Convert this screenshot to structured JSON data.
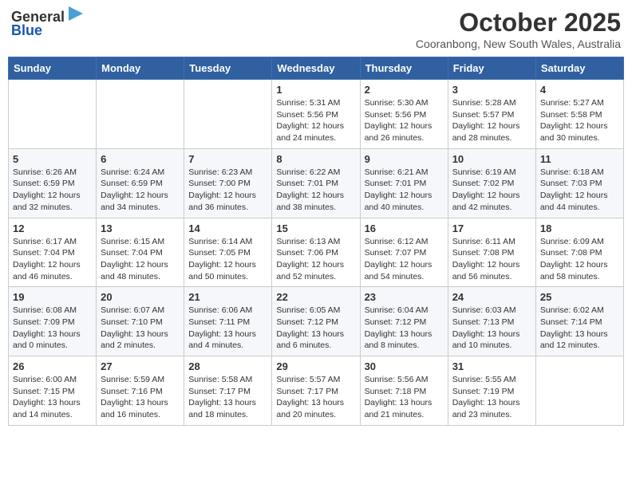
{
  "header": {
    "logo_line1": "General",
    "logo_line2": "Blue",
    "month": "October 2025",
    "location": "Cooranbong, New South Wales, Australia"
  },
  "weekdays": [
    "Sunday",
    "Monday",
    "Tuesday",
    "Wednesday",
    "Thursday",
    "Friday",
    "Saturday"
  ],
  "weeks": [
    [
      {
        "day": "",
        "info": ""
      },
      {
        "day": "",
        "info": ""
      },
      {
        "day": "",
        "info": ""
      },
      {
        "day": "1",
        "info": "Sunrise: 5:31 AM\nSunset: 5:56 PM\nDaylight: 12 hours\nand 24 minutes."
      },
      {
        "day": "2",
        "info": "Sunrise: 5:30 AM\nSunset: 5:56 PM\nDaylight: 12 hours\nand 26 minutes."
      },
      {
        "day": "3",
        "info": "Sunrise: 5:28 AM\nSunset: 5:57 PM\nDaylight: 12 hours\nand 28 minutes."
      },
      {
        "day": "4",
        "info": "Sunrise: 5:27 AM\nSunset: 5:58 PM\nDaylight: 12 hours\nand 30 minutes."
      }
    ],
    [
      {
        "day": "5",
        "info": "Sunrise: 6:26 AM\nSunset: 6:59 PM\nDaylight: 12 hours\nand 32 minutes."
      },
      {
        "day": "6",
        "info": "Sunrise: 6:24 AM\nSunset: 6:59 PM\nDaylight: 12 hours\nand 34 minutes."
      },
      {
        "day": "7",
        "info": "Sunrise: 6:23 AM\nSunset: 7:00 PM\nDaylight: 12 hours\nand 36 minutes."
      },
      {
        "day": "8",
        "info": "Sunrise: 6:22 AM\nSunset: 7:01 PM\nDaylight: 12 hours\nand 38 minutes."
      },
      {
        "day": "9",
        "info": "Sunrise: 6:21 AM\nSunset: 7:01 PM\nDaylight: 12 hours\nand 40 minutes."
      },
      {
        "day": "10",
        "info": "Sunrise: 6:19 AM\nSunset: 7:02 PM\nDaylight: 12 hours\nand 42 minutes."
      },
      {
        "day": "11",
        "info": "Sunrise: 6:18 AM\nSunset: 7:03 PM\nDaylight: 12 hours\nand 44 minutes."
      }
    ],
    [
      {
        "day": "12",
        "info": "Sunrise: 6:17 AM\nSunset: 7:04 PM\nDaylight: 12 hours\nand 46 minutes."
      },
      {
        "day": "13",
        "info": "Sunrise: 6:15 AM\nSunset: 7:04 PM\nDaylight: 12 hours\nand 48 minutes."
      },
      {
        "day": "14",
        "info": "Sunrise: 6:14 AM\nSunset: 7:05 PM\nDaylight: 12 hours\nand 50 minutes."
      },
      {
        "day": "15",
        "info": "Sunrise: 6:13 AM\nSunset: 7:06 PM\nDaylight: 12 hours\nand 52 minutes."
      },
      {
        "day": "16",
        "info": "Sunrise: 6:12 AM\nSunset: 7:07 PM\nDaylight: 12 hours\nand 54 minutes."
      },
      {
        "day": "17",
        "info": "Sunrise: 6:11 AM\nSunset: 7:08 PM\nDaylight: 12 hours\nand 56 minutes."
      },
      {
        "day": "18",
        "info": "Sunrise: 6:09 AM\nSunset: 7:08 PM\nDaylight: 12 hours\nand 58 minutes."
      }
    ],
    [
      {
        "day": "19",
        "info": "Sunrise: 6:08 AM\nSunset: 7:09 PM\nDaylight: 13 hours\nand 0 minutes."
      },
      {
        "day": "20",
        "info": "Sunrise: 6:07 AM\nSunset: 7:10 PM\nDaylight: 13 hours\nand 2 minutes."
      },
      {
        "day": "21",
        "info": "Sunrise: 6:06 AM\nSunset: 7:11 PM\nDaylight: 13 hours\nand 4 minutes."
      },
      {
        "day": "22",
        "info": "Sunrise: 6:05 AM\nSunset: 7:12 PM\nDaylight: 13 hours\nand 6 minutes."
      },
      {
        "day": "23",
        "info": "Sunrise: 6:04 AM\nSunset: 7:12 PM\nDaylight: 13 hours\nand 8 minutes."
      },
      {
        "day": "24",
        "info": "Sunrise: 6:03 AM\nSunset: 7:13 PM\nDaylight: 13 hours\nand 10 minutes."
      },
      {
        "day": "25",
        "info": "Sunrise: 6:02 AM\nSunset: 7:14 PM\nDaylight: 13 hours\nand 12 minutes."
      }
    ],
    [
      {
        "day": "26",
        "info": "Sunrise: 6:00 AM\nSunset: 7:15 PM\nDaylight: 13 hours\nand 14 minutes."
      },
      {
        "day": "27",
        "info": "Sunrise: 5:59 AM\nSunset: 7:16 PM\nDaylight: 13 hours\nand 16 minutes."
      },
      {
        "day": "28",
        "info": "Sunrise: 5:58 AM\nSunset: 7:17 PM\nDaylight: 13 hours\nand 18 minutes."
      },
      {
        "day": "29",
        "info": "Sunrise: 5:57 AM\nSunset: 7:17 PM\nDaylight: 13 hours\nand 20 minutes."
      },
      {
        "day": "30",
        "info": "Sunrise: 5:56 AM\nSunset: 7:18 PM\nDaylight: 13 hours\nand 21 minutes."
      },
      {
        "day": "31",
        "info": "Sunrise: 5:55 AM\nSunset: 7:19 PM\nDaylight: 13 hours\nand 23 minutes."
      },
      {
        "day": "",
        "info": ""
      }
    ]
  ]
}
